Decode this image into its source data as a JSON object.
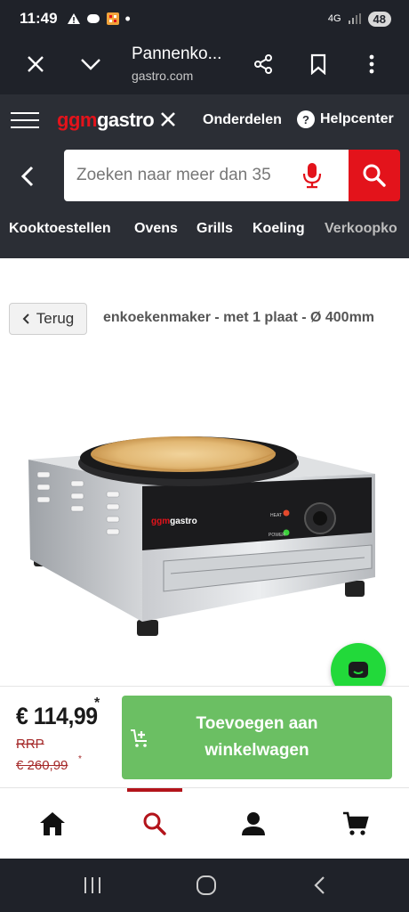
{
  "status_bar": {
    "time": "11:49",
    "network": "4G",
    "battery": "48"
  },
  "browser": {
    "title": "Pannenko...",
    "url": "gastro.com"
  },
  "site": {
    "logo_ggm": "ggm",
    "logo_gastro": "gastro",
    "nav_parts": "Onderdelen",
    "nav_help": "Helpcenter",
    "search_placeholder": "Zoeken naar meer dan 35",
    "categories": [
      "Kooktoestellen",
      "Ovens",
      "Grills",
      "Koeling",
      "Verkoopko"
    ]
  },
  "product": {
    "back_label": "Terug",
    "breadcrumb": "enkoekenmaker - met 1 plaat - Ø 400mm",
    "image_logo": "ggmgastro",
    "heat_label": "HEAT",
    "power_label": "POWER"
  },
  "purchase": {
    "price": "€ 114,99",
    "price_marker": "*",
    "rrp_label": "RRP",
    "rrp_value": "€ 260,99",
    "rrp_marker": "*",
    "add_to_cart": "Toevoegen aan winkelwagen"
  },
  "colors": {
    "brand_red": "#e3131b",
    "header_dark": "#2b2e35",
    "cta_green": "#6bbf63",
    "chat_green": "#22d93a"
  },
  "bottom_nav": {
    "items": [
      "home-icon",
      "search-icon",
      "account-icon",
      "cart-icon"
    ],
    "active": "search-icon"
  }
}
